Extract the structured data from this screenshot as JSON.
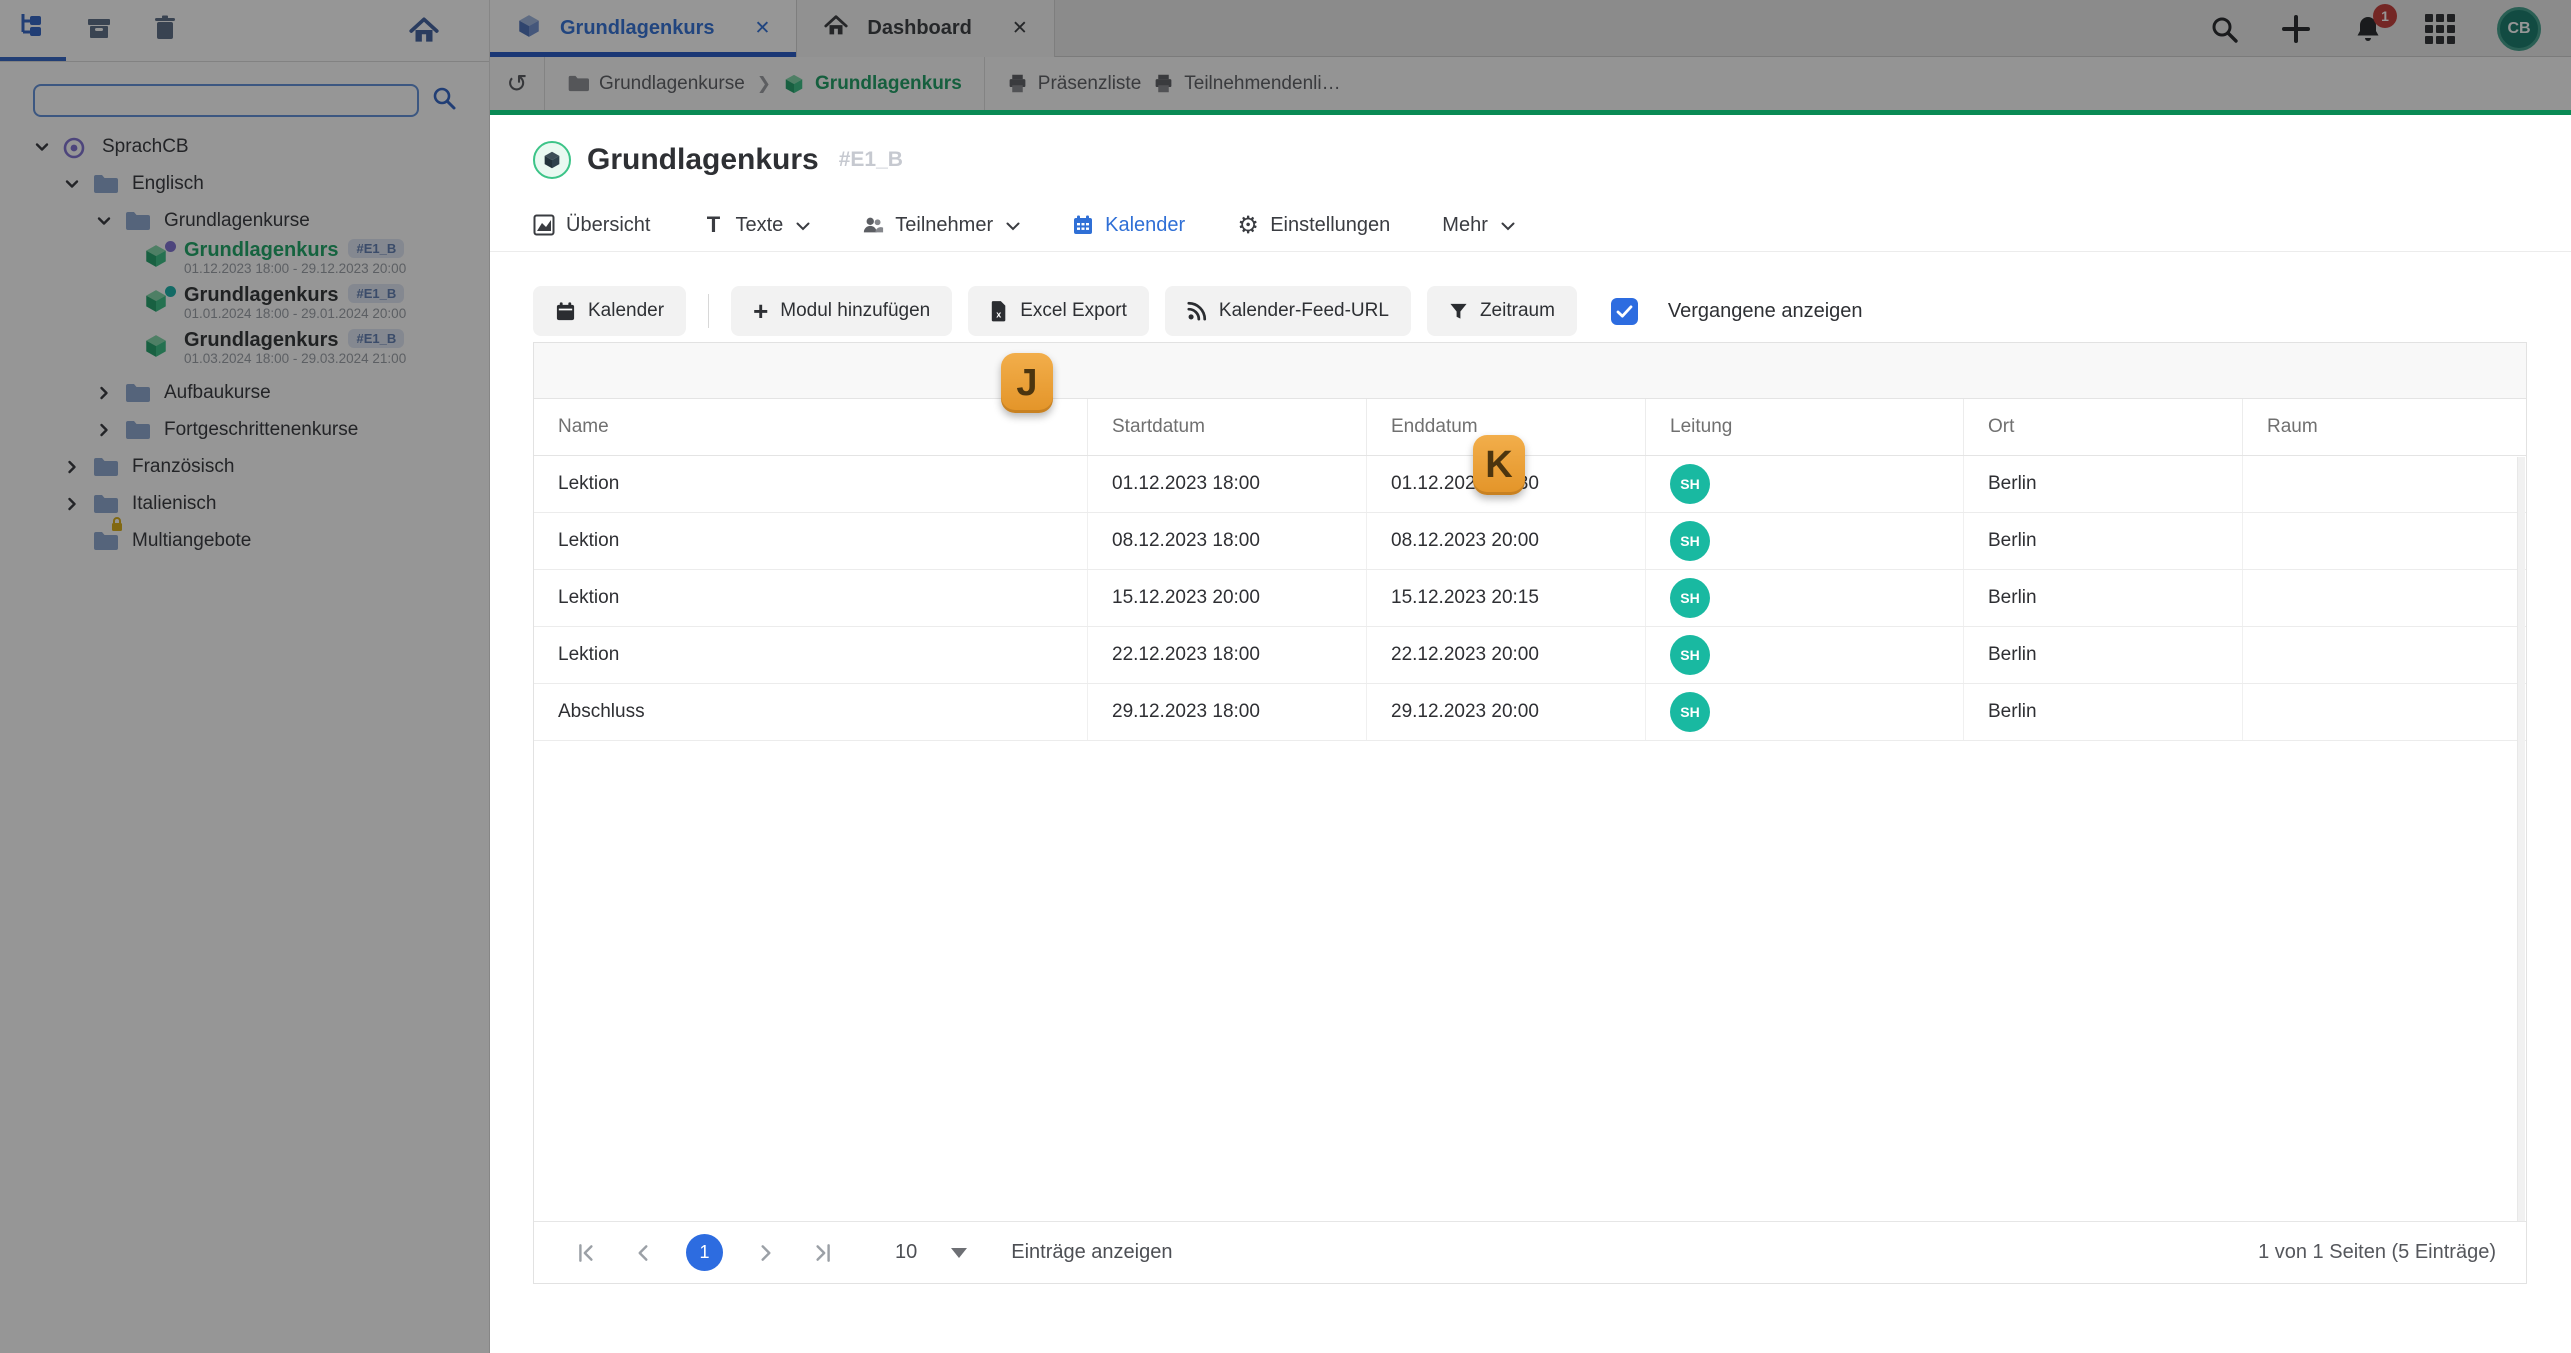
{
  "colors": {
    "accent_blue": "#2f6fd6",
    "accent_green": "#0a8a55",
    "selected_green": "#1aa564",
    "avatar_teal": "#19b9a1",
    "hint_orange": "#eda43c",
    "notification_red": "#c23a36",
    "checkbox_blue": "#2d6ce0"
  },
  "sidebar": {
    "tools": {
      "tree_tab": "tree-structure-icon",
      "archive_tab": "archive-icon",
      "trash_tab": "trash-icon",
      "home": "home-icon"
    },
    "search": {
      "value": "",
      "placeholder": ""
    },
    "tree": [
      {
        "label": "SprachCB",
        "level": 0,
        "icon": "target-icon",
        "state": "expanded"
      },
      {
        "label": "Englisch",
        "level": 1,
        "icon": "folder-icon",
        "state": "expanded"
      },
      {
        "label": "Grundlagenkurse",
        "level": 2,
        "icon": "folder-icon",
        "state": "expanded"
      },
      {
        "label": "Grundlagenkurs",
        "badge": "#E1_B",
        "dates": "01.12.2023 18:00 - 29.12.2023 20:00",
        "level": 3,
        "icon": "course-cube-icon",
        "selected": true,
        "dot": "purple"
      },
      {
        "label": "Grundlagenkurs",
        "badge": "#E1_B",
        "dates": "01.01.2024 18:00 - 29.01.2024 20:00",
        "level": 3,
        "icon": "course-cube-icon",
        "dot": "teal"
      },
      {
        "label": "Grundlagenkurs",
        "badge": "#E1_B",
        "dates": "01.03.2024 18:00 - 29.03.2024 21:00",
        "level": 3,
        "icon": "course-cube-icon"
      },
      {
        "label": "Aufbaukurse",
        "level": 2,
        "icon": "folder-icon",
        "state": "collapsed"
      },
      {
        "label": "Fortgeschrittenenkurse",
        "level": 2,
        "icon": "folder-icon",
        "state": "collapsed"
      },
      {
        "label": "Französisch",
        "level": 1,
        "icon": "folder-icon",
        "state": "collapsed"
      },
      {
        "label": "Italienisch",
        "level": 1,
        "icon": "folder-icon",
        "state": "collapsed"
      },
      {
        "label": "Multiangebote",
        "level": 1,
        "icon": "folder-locked-icon",
        "locked": true
      }
    ]
  },
  "topbar": {
    "tabs": [
      {
        "label": "Grundlagenkurs",
        "icon": "cube-icon",
        "active": true
      },
      {
        "label": "Dashboard",
        "icon": "home-icon",
        "active": false
      }
    ],
    "close_glyph": "✕",
    "notification_count": "1",
    "avatar_initials": "CB"
  },
  "breadcrumb": {
    "history_glyph": "↺",
    "items": [
      {
        "label": "Grundlagenkurse",
        "icon": "folder-icon"
      },
      {
        "label": "Grundlagenkurs",
        "icon": "cube-icon",
        "current": true
      }
    ],
    "separator": "❯",
    "documents": [
      {
        "label": "Präsenzliste",
        "icon": "printer-icon"
      },
      {
        "label": "Teilnehmendenli…",
        "icon": "printer-icon"
      }
    ]
  },
  "page": {
    "title": "Grundlagenkurs",
    "code": "#E1_B"
  },
  "nav": {
    "items": [
      {
        "label": "Übersicht",
        "icon": "chart-icon"
      },
      {
        "label": "Texte",
        "icon": "text-icon",
        "dropdown": true
      },
      {
        "label": "Teilnehmer",
        "icon": "people-icon",
        "dropdown": true
      },
      {
        "label": "Kalender",
        "icon": "calendar-icon",
        "active": true
      },
      {
        "label": "Einstellungen",
        "icon": "gear-icon"
      },
      {
        "label": "Mehr",
        "dropdown": true
      }
    ]
  },
  "toolbar": {
    "buttons": [
      {
        "label": "Kalender",
        "icon": "calendar-icon"
      },
      {
        "label": "Modul hinzufügen",
        "icon": "plus-icon"
      },
      {
        "label": "Excel Export",
        "icon": "excel-file-icon"
      },
      {
        "label": "Kalender-Feed-URL",
        "icon": "rss-icon"
      },
      {
        "label": "Zeitraum",
        "icon": "funnel-icon"
      }
    ],
    "checkbox": {
      "label": "Vergangene anzeigen",
      "checked": true
    }
  },
  "hints": {
    "j": "J",
    "k": "K"
  },
  "table": {
    "columns": [
      "Name",
      "Startdatum",
      "Enddatum",
      "Leitung",
      "Ort",
      "Raum"
    ],
    "rows": [
      {
        "name": "Lektion",
        "start": "01.12.2023 18:00",
        "end": "01.12.2023 20:30",
        "leader": "SH",
        "ort": "Berlin",
        "raum": ""
      },
      {
        "name": "Lektion",
        "start": "08.12.2023 18:00",
        "end": "08.12.2023 20:00",
        "leader": "SH",
        "ort": "Berlin",
        "raum": ""
      },
      {
        "name": "Lektion",
        "start": "15.12.2023 20:00",
        "end": "15.12.2023 20:15",
        "leader": "SH",
        "ort": "Berlin",
        "raum": ""
      },
      {
        "name": "Lektion",
        "start": "22.12.2023 18:00",
        "end": "22.12.2023 20:00",
        "leader": "SH",
        "ort": "Berlin",
        "raum": ""
      },
      {
        "name": "Abschluss",
        "start": "29.12.2023 18:00",
        "end": "29.12.2023 20:00",
        "leader": "SH",
        "ort": "Berlin",
        "raum": ""
      }
    ]
  },
  "pagination": {
    "current_page": "1",
    "page_size": "10",
    "page_size_label": "Einträge anzeigen",
    "summary": "1 von 1 Seiten (5 Einträge)"
  }
}
